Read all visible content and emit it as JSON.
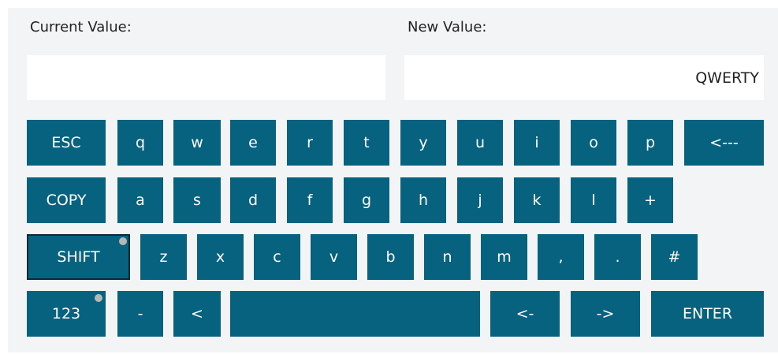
{
  "labels": {
    "current": "Current Value:",
    "new": "New Value:"
  },
  "fields": {
    "current_value": "",
    "new_value": "QWERTY"
  },
  "keys": {
    "esc": "ESC",
    "q": "q",
    "w": "w",
    "e": "e",
    "r": "r",
    "t": "t",
    "y": "y",
    "u": "u",
    "i": "i",
    "o": "o",
    "p": "p",
    "backspace": "<---",
    "copy": "COPY",
    "a": "a",
    "s": "s",
    "d": "d",
    "f": "f",
    "g": "g",
    "h": "h",
    "j": "j",
    "k": "k",
    "l": "l",
    "plus": "+",
    "shift": "SHIFT",
    "z": "z",
    "x": "x",
    "c": "c",
    "v": "v",
    "b": "b",
    "n": "n",
    "m": "m",
    "comma": ",",
    "period": ".",
    "hash": "#",
    "num": "123",
    "minus": "-",
    "less": "<",
    "space": "",
    "left": "<-",
    "right": "->",
    "enter": "ENTER"
  },
  "colors": {
    "key_bg": "#06627f",
    "key_text": "#ffffff",
    "panel_bg": "#f2f4f6"
  }
}
